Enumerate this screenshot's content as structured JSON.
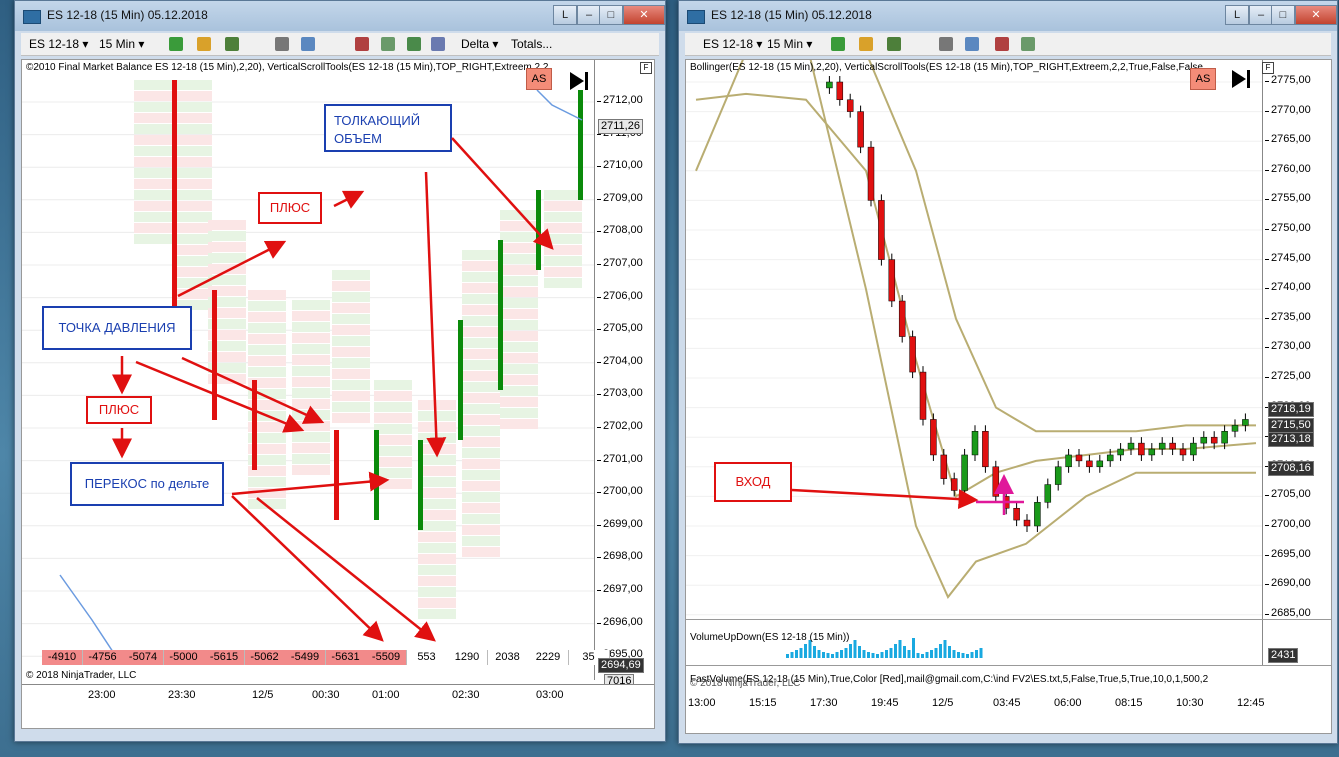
{
  "left_window": {
    "title": "ES 12-18 (15 Min)  05.12.2018",
    "instrument_dd": "ES 12-18",
    "interval_dd": "15 Min",
    "delta_dd": "Delta",
    "totals_dd": "Totals...",
    "indicator_header": "©2010 Final Market Balance    ES 12-18 (15 Min),2,20), VerticalScrollTools(ES 12-18 (15 Min),TOP_RIGHT,Extreem,2,2,",
    "as_label": "AS",
    "f_label": "F",
    "copyright": "© 2018 NinjaTrader, LLC",
    "price_ticks": [
      "2712,00",
      "2711,00",
      "2710,00",
      "2709,00",
      "2708,00",
      "2707,00",
      "2706,00",
      "2705,00",
      "2704,00",
      "2703,00",
      "2702,00",
      "2701,00",
      "2700,00",
      "2699,00",
      "2698,00",
      "2697,00",
      "2696,00",
      "2695,00"
    ],
    "current_price": "2711,26",
    "bottom_price": "2694,69",
    "bottom_vol": "7016",
    "time_ticks": [
      "23:00",
      "23:30",
      "12/5",
      "00:30",
      "01:00",
      "02:30",
      "03:00"
    ],
    "delta_totals": [
      "-4910",
      "-4756",
      "-5074",
      "-5000",
      "-5615",
      "-5062",
      "-5499",
      "-5631",
      "-5509",
      "553",
      "1290",
      "2038",
      "2229",
      "35"
    ],
    "annotations": {
      "push_volume": "ТОЛКАЮЩИЙ ОБЪЕМ",
      "plus_top": "ПЛЮС",
      "pressure_point": "ТОЧКА ДАВЛЕНИЯ",
      "plus_mid": "ПЛЮС",
      "delta_skew": "ПЕРЕКОС по дельте"
    }
  },
  "right_window": {
    "title": "ES 12-18 (15 Min)  05.12.2018",
    "instrument_dd": "ES 12-18",
    "interval_dd": "15 Min",
    "indicator_header": "Bollinger(ES 12-18 (15 Min),2,20), VerticalScrollTools(ES 12-18 (15 Min),TOP_RIGHT,Extreem,2,2,True,False,False",
    "as_label": "AS",
    "f_label": "F",
    "price_ticks": [
      "2775,00",
      "2770,00",
      "2765,00",
      "2760,00",
      "2755,00",
      "2750,00",
      "2745,00",
      "2740,00",
      "2735,00",
      "2730,00",
      "2725,00",
      "2720,00",
      "2715,00",
      "2710,00",
      "2705,00",
      "2700,00",
      "2695,00",
      "2690,00",
      "2685,00"
    ],
    "price_boxes": [
      "2718,19",
      "2715,50",
      "2713,18",
      "2708,16"
    ],
    "entry_label": "ВХОД",
    "volume_header": "VolumeUpDown(ES 12-18 (15 Min))",
    "volume_value": "2431",
    "fastvolume_header": "FastVolume(ES 12-18 (15 Min),True,Color [Red],mail@gmail.com,C:\\ind FV2\\ES.txt,5,False,True,5,True,10,0,1,500,2",
    "copyright": "© 2018 NinjaTrader, LLC",
    "time_ticks": [
      "13:00",
      "15:15",
      "17:30",
      "19:45",
      "12/5",
      "03:45",
      "06:00",
      "08:15",
      "10:30",
      "12:45"
    ]
  },
  "colors": {
    "bull": "#0a8a0a",
    "bear": "#e01010",
    "ann_red": "#e01010",
    "ann_blue": "#1a3fb0",
    "bollinger": "#b9ad72",
    "volume": "#19a9e0"
  }
}
